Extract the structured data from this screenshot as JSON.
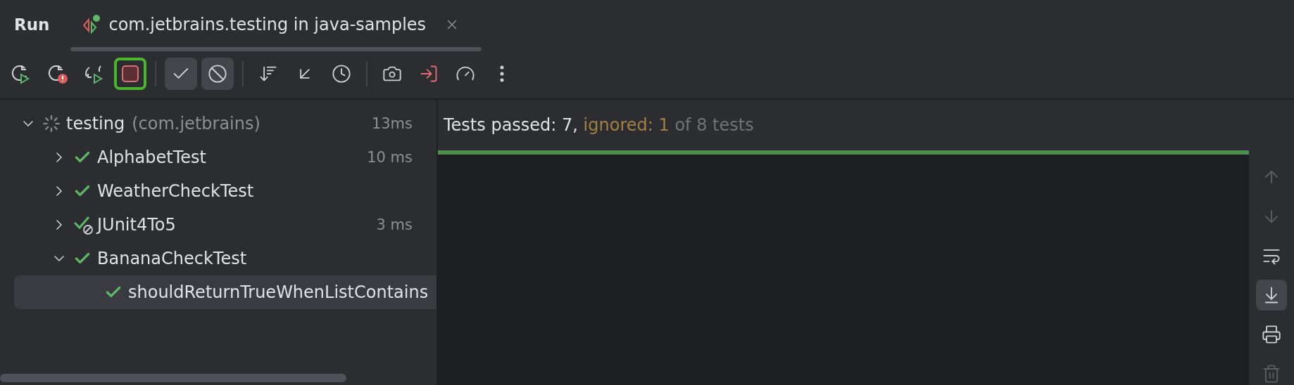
{
  "header": {
    "title": "Run",
    "tab": {
      "label": "com.jetbrains.testing in java-samples",
      "selected": true
    }
  },
  "toolbar": [
    {
      "kind": "rerun",
      "selected": false,
      "focused": false
    },
    {
      "kind": "rerun-failed",
      "selected": false,
      "focused": false
    },
    {
      "kind": "auto-rerun",
      "selected": false,
      "focused": false
    },
    {
      "kind": "stop",
      "selected": false,
      "focused": true
    },
    {
      "kind": "separator"
    },
    {
      "kind": "show-passed",
      "selected": true,
      "focused": false
    },
    {
      "kind": "show-ignored",
      "selected": true,
      "focused": false
    },
    {
      "kind": "separator"
    },
    {
      "kind": "sort",
      "selected": false,
      "focused": false
    },
    {
      "kind": "collapse",
      "selected": false,
      "focused": false
    },
    {
      "kind": "history",
      "selected": false,
      "focused": false
    },
    {
      "kind": "separator"
    },
    {
      "kind": "camera",
      "selected": false,
      "focused": false
    },
    {
      "kind": "import",
      "selected": false,
      "focused": false
    },
    {
      "kind": "gauge",
      "selected": false,
      "focused": false
    },
    {
      "kind": "more",
      "selected": false,
      "focused": false
    }
  ],
  "tree": [
    {
      "name": "testing",
      "detail": "(com.jetbrains)",
      "time": "13ms",
      "kind": "running",
      "expanded": true,
      "selected": false,
      "children": [
        {
          "name": "AlphabetTest",
          "time": "10 ms",
          "kind": "passed",
          "expanded": false,
          "selected": false
        },
        {
          "name": "WeatherCheckTest",
          "kind": "passed",
          "expanded": false,
          "selected": false
        },
        {
          "name": "JUnit4To5",
          "time": "3 ms",
          "kind": "passed-ignored",
          "expanded": false,
          "selected": false
        },
        {
          "name": "BananaCheckTest",
          "kind": "passed",
          "expanded": true,
          "selected": false,
          "children": [
            {
              "name": "shouldReturnTrueWhenListContains",
              "kind": "passed",
              "selected": true
            }
          ]
        }
      ]
    }
  ],
  "summary": {
    "passed": "Tests passed: 7,",
    "ignored": "ignored: 1",
    "total": "of 8 tests",
    "level": 1
  },
  "side_actions": [
    {
      "kind": "up",
      "disabled": true,
      "selected": false
    },
    {
      "kind": "down",
      "disabled": true,
      "selected": false
    },
    {
      "kind": "wrap",
      "disabled": false,
      "selected": false
    },
    {
      "kind": "scroll-end",
      "disabled": false,
      "selected": true
    },
    {
      "kind": "print",
      "disabled": false,
      "selected": false
    },
    {
      "kind": "clear",
      "disabled": true,
      "selected": false
    }
  ]
}
